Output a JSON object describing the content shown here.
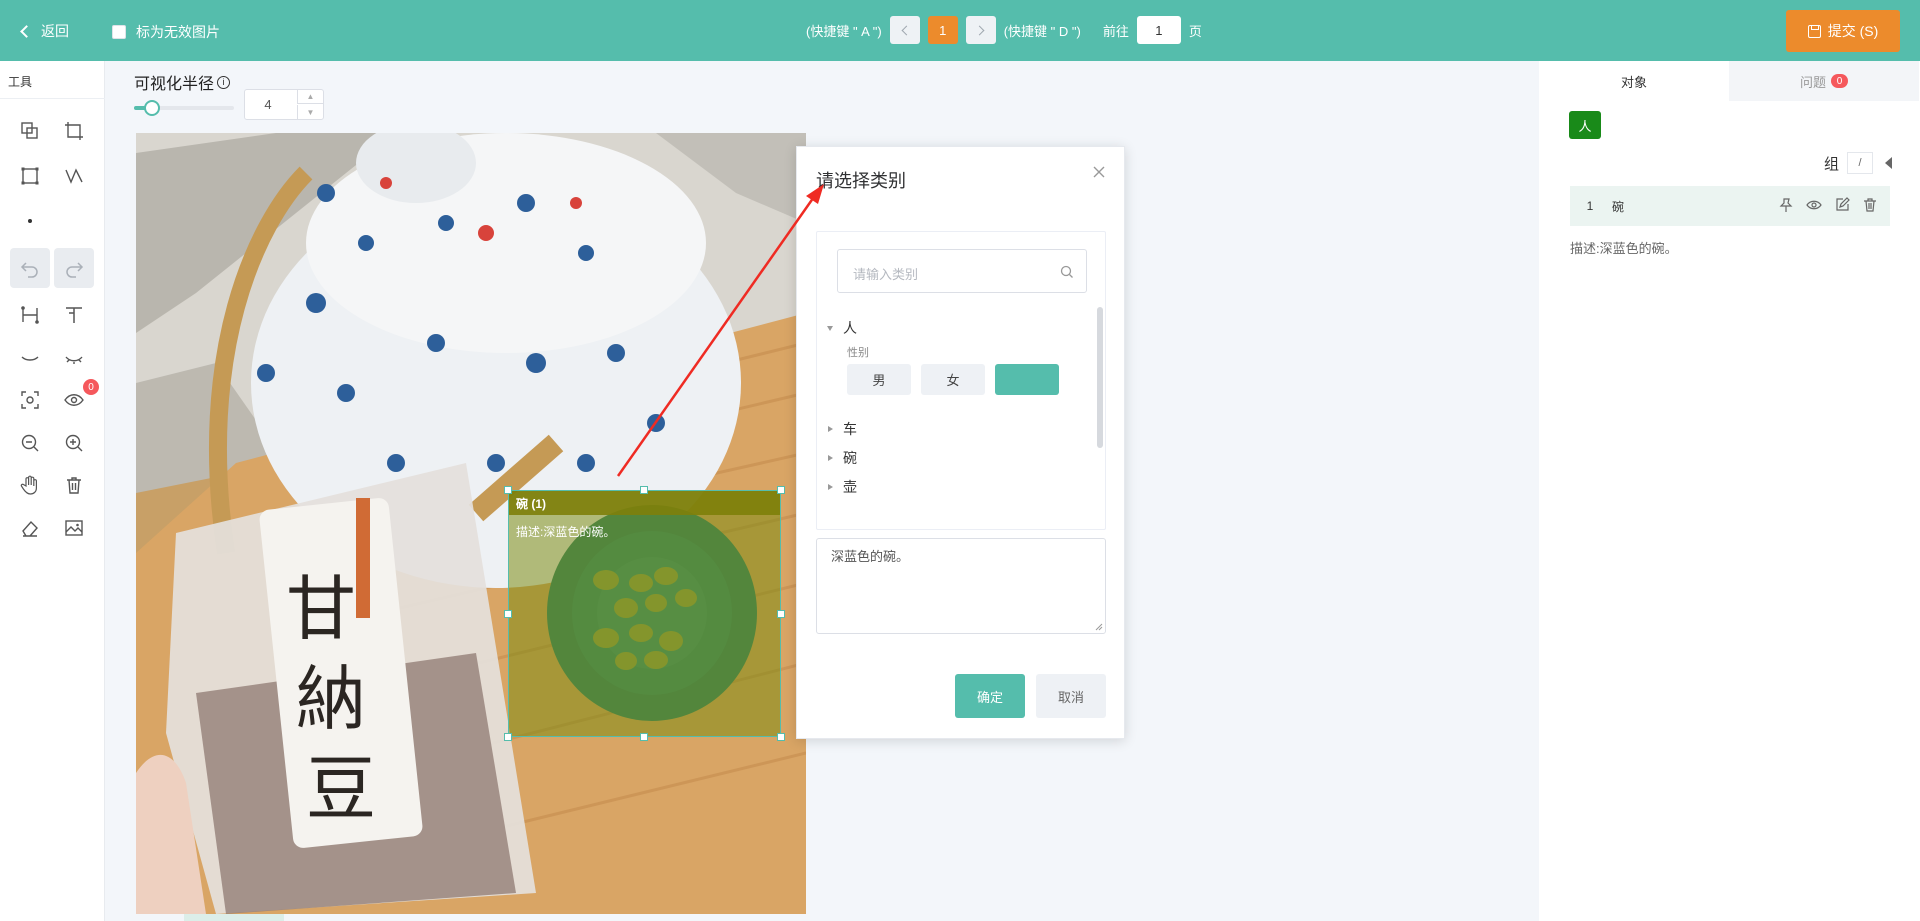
{
  "topbar": {
    "back_label": "返回",
    "invalid_label": "标为无效图片",
    "prev_hint": "(快捷键 \" A \")",
    "current_page": "1",
    "next_hint": "(快捷键 \" D \")",
    "goto_label": "前往",
    "goto_value": "1",
    "page_unit": "页",
    "submit_label": "提交 (S)"
  },
  "tools": {
    "title": "工具",
    "badge": "0",
    "icons": [
      "copy-icon",
      "crop-icon",
      "rectangle-icon",
      "polyline-icon",
      "point-icon",
      "undo-icon",
      "redo-icon",
      "keypoint-icon",
      "text-tool-icon",
      "eye-closed-icon",
      "eyelash-icon",
      "focus-icon",
      "eye-icon",
      "zoom-out-icon",
      "zoom-in-icon",
      "hand-icon",
      "trash-icon",
      "eraser-icon",
      "image-icon"
    ]
  },
  "canvas": {
    "radius_label": "可视化半径",
    "radius_info": "i",
    "radius_value": "4",
    "radius_fraction": 0.1
  },
  "annotation": {
    "label": "碗 (1)",
    "desc": "描述:深蓝色的碗。"
  },
  "dialog": {
    "title": "请选择类别",
    "search_placeholder": "请输入类别",
    "tree": [
      {
        "label": "人",
        "expanded": true,
        "attr_label": "性别",
        "options": [
          "男",
          "女",
          ""
        ]
      },
      {
        "label": "车"
      },
      {
        "label": "碗"
      },
      {
        "label": "壶"
      }
    ],
    "textarea_value": "深蓝色的碗。",
    "confirm_label": "确定",
    "cancel_label": "取消"
  },
  "right_panel": {
    "tab_objects": "对象",
    "tab_issues": "问题",
    "issues_count": "0",
    "person_tag": "人",
    "group_label": "组",
    "group_slash": "/",
    "objects": [
      {
        "index": "1",
        "name": "碗",
        "desc": "描述:深蓝色的碗。"
      }
    ]
  },
  "colors": {
    "primary": "#55bdac",
    "accent": "#ec8b2c",
    "badge": "#f5585c",
    "person_tag": "#198a19"
  }
}
